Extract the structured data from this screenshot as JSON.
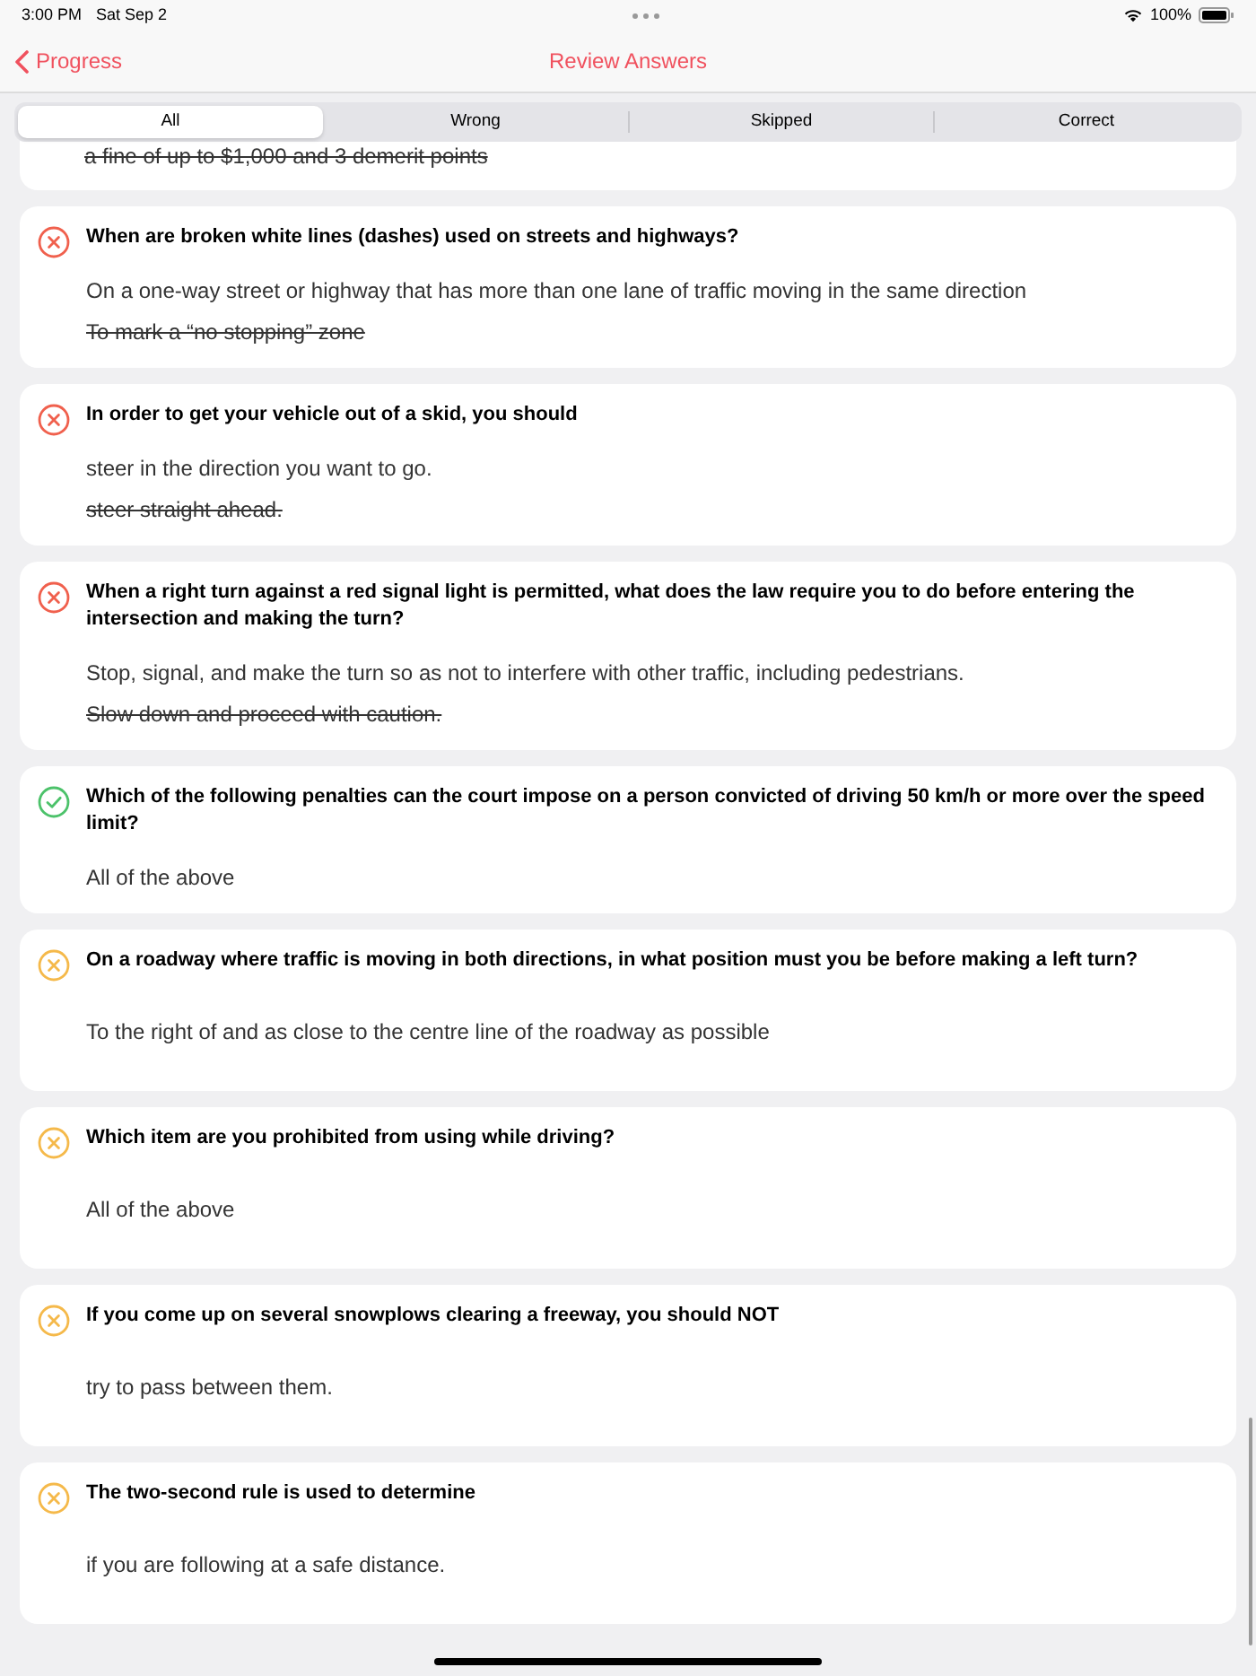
{
  "status_bar": {
    "time": "3:00 PM",
    "date": "Sat Sep 2",
    "battery": "100%"
  },
  "nav": {
    "back": "Progress",
    "title": "Review Answers"
  },
  "tabs": [
    {
      "label": "All",
      "selected": true
    },
    {
      "label": "Wrong",
      "selected": false
    },
    {
      "label": "Skipped",
      "selected": false
    },
    {
      "label": "Correct",
      "selected": false
    }
  ],
  "questions": [
    {
      "kind": "partial",
      "answers": [
        {
          "text": "a fine of up to $1,000 and 3 demerit points",
          "kind": "chosen"
        }
      ]
    },
    {
      "kind": "wrong",
      "question": "When are broken white lines (dashes) used on streets and highways?",
      "answers": [
        {
          "text": "On a one-way street or highway that has more than one lane of traffic moving in the same direction",
          "kind": "correct"
        },
        {
          "text": "To mark a “no stopping” zone",
          "kind": "chosen"
        }
      ]
    },
    {
      "kind": "wrong",
      "question": "In order to get your vehicle out of a skid, you should",
      "answers": [
        {
          "text": "steer in the direction you want to go.",
          "kind": "correct"
        },
        {
          "text": "steer straight ahead.",
          "kind": "chosen"
        }
      ]
    },
    {
      "kind": "wrong",
      "question": "When a right turn against a red signal light is permitted, what does the law require you to do before entering the intersection and making the turn?",
      "answers": [
        {
          "text": "Stop, signal, and make the turn so as not to interfere with other traffic, including pedestrians.",
          "kind": "correct"
        },
        {
          "text": "Slow down and proceed with caution.",
          "kind": "chosen"
        }
      ]
    },
    {
      "kind": "correct",
      "question": "Which of the following penalties can the court impose on a person convicted of driving 50 km/h or more over the speed limit?",
      "answers": [
        {
          "text": "All of the above",
          "kind": "correct"
        }
      ]
    },
    {
      "kind": "skipped",
      "question": "On a roadway where traffic is moving in both directions, in what position must you be before making a left turn?",
      "answers": [
        {
          "text": "To the right of and as close to the centre line of the roadway as possible",
          "kind": "correct"
        }
      ]
    },
    {
      "kind": "skipped",
      "question": "Which item are you prohibited from using while driving?",
      "answers": [
        {
          "text": "All of the above",
          "kind": "correct"
        }
      ]
    },
    {
      "kind": "skipped",
      "question": "If you come up on several snowplows clearing a freeway, you should NOT",
      "answers": [
        {
          "text": "try to pass between them.",
          "kind": "correct"
        }
      ]
    },
    {
      "kind": "skipped",
      "question": "The two-second rule is used to determine",
      "answers": [
        {
          "text": "if you are following at a safe distance.",
          "kind": "correct"
        }
      ]
    }
  ]
}
